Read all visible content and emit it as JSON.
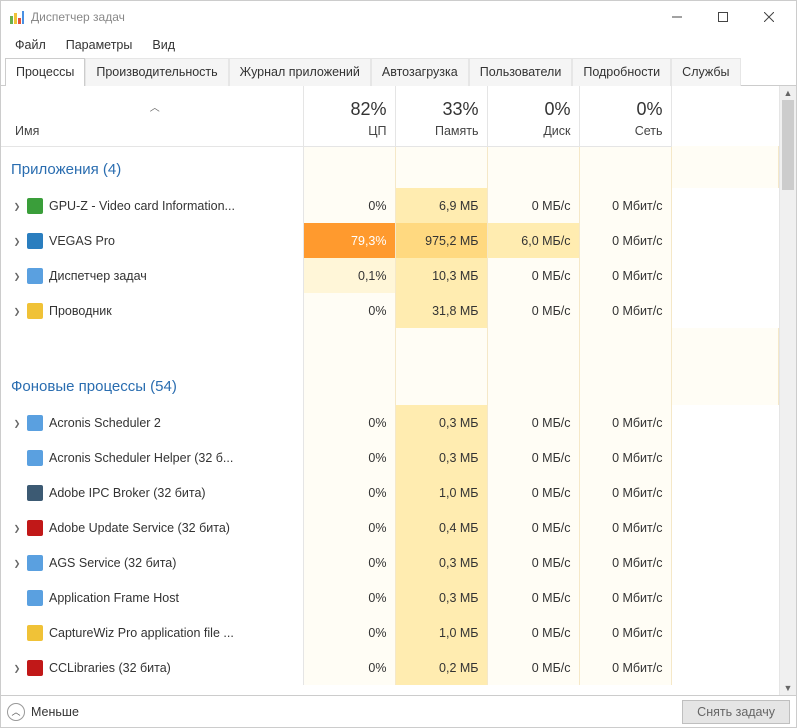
{
  "window": {
    "title": "Диспетчер задач"
  },
  "menu": {
    "file": "Файл",
    "options": "Параметры",
    "view": "Вид"
  },
  "tabs": {
    "processes": "Процессы",
    "performance": "Производительность",
    "apphistory": "Журнал приложений",
    "startup": "Автозагрузка",
    "users": "Пользователи",
    "details": "Подробности",
    "services": "Службы"
  },
  "columns": {
    "name": "Имя",
    "cpu_pct": "82%",
    "cpu_label": "ЦП",
    "mem_pct": "33%",
    "mem_label": "Память",
    "disk_pct": "0%",
    "disk_label": "Диск",
    "net_pct": "0%",
    "net_label": "Сеть"
  },
  "groups": {
    "apps": "Приложения (4)",
    "bg": "Фоновые процессы (54)"
  },
  "rows": {
    "apps": [
      {
        "expand": true,
        "icon": "#3a9e3a",
        "name": "GPU-Z - Video card Information...",
        "cpu": "0%",
        "cpu_h": 0,
        "mem": "6,9 МБ",
        "mem_h": 2,
        "disk": "0 МБ/с",
        "disk_h": 0,
        "net": "0 Мбит/с",
        "net_h": 0
      },
      {
        "expand": true,
        "icon": "#2a7ebf",
        "name": "VEGAS Pro",
        "cpu": "79,3%",
        "cpu_h": 9,
        "mem": "975,2 МБ",
        "mem_h": 3,
        "disk": "6,0 МБ/с",
        "disk_h": 2,
        "net": "0 Мбит/с",
        "net_h": 0
      },
      {
        "expand": true,
        "icon": "#5aa0e0",
        "name": "Диспетчер задач",
        "cpu": "0,1%",
        "cpu_h": 1,
        "mem": "10,3 МБ",
        "mem_h": 2,
        "disk": "0 МБ/с",
        "disk_h": 0,
        "net": "0 Мбит/с",
        "net_h": 0
      },
      {
        "expand": true,
        "icon": "#f0c237",
        "name": "Проводник",
        "cpu": "0%",
        "cpu_h": 0,
        "mem": "31,8 МБ",
        "mem_h": 2,
        "disk": "0 МБ/с",
        "disk_h": 0,
        "net": "0 Мбит/с",
        "net_h": 0
      }
    ],
    "bg": [
      {
        "expand": true,
        "icon": "#5aa0e0",
        "name": "Acronis Scheduler 2",
        "cpu": "0%",
        "cpu_h": 0,
        "mem": "0,3 МБ",
        "mem_h": 2,
        "disk": "0 МБ/с",
        "disk_h": 0,
        "net": "0 Мбит/с",
        "net_h": 0
      },
      {
        "expand": false,
        "icon": "#5aa0e0",
        "name": "Acronis Scheduler Helper (32 б...",
        "cpu": "0%",
        "cpu_h": 0,
        "mem": "0,3 МБ",
        "mem_h": 2,
        "disk": "0 МБ/с",
        "disk_h": 0,
        "net": "0 Мбит/с",
        "net_h": 0
      },
      {
        "expand": false,
        "icon": "#3c5a73",
        "name": "Adobe IPC Broker (32 бита)",
        "cpu": "0%",
        "cpu_h": 0,
        "mem": "1,0 МБ",
        "mem_h": 2,
        "disk": "0 МБ/с",
        "disk_h": 0,
        "net": "0 Мбит/с",
        "net_h": 0
      },
      {
        "expand": true,
        "icon": "#c11818",
        "name": "Adobe Update Service (32 бита)",
        "cpu": "0%",
        "cpu_h": 0,
        "mem": "0,4 МБ",
        "mem_h": 2,
        "disk": "0 МБ/с",
        "disk_h": 0,
        "net": "0 Мбит/с",
        "net_h": 0
      },
      {
        "expand": true,
        "icon": "#5aa0e0",
        "name": "AGS Service (32 бита)",
        "cpu": "0%",
        "cpu_h": 0,
        "mem": "0,3 МБ",
        "mem_h": 2,
        "disk": "0 МБ/с",
        "disk_h": 0,
        "net": "0 Мбит/с",
        "net_h": 0
      },
      {
        "expand": false,
        "icon": "#5aa0e0",
        "name": "Application Frame Host",
        "cpu": "0%",
        "cpu_h": 0,
        "mem": "0,3 МБ",
        "mem_h": 2,
        "disk": "0 МБ/с",
        "disk_h": 0,
        "net": "0 Мбит/с",
        "net_h": 0
      },
      {
        "expand": false,
        "icon": "#f0c237",
        "name": "CaptureWiz Pro application file ...",
        "cpu": "0%",
        "cpu_h": 0,
        "mem": "1,0 МБ",
        "mem_h": 2,
        "disk": "0 МБ/с",
        "disk_h": 0,
        "net": "0 Мбит/с",
        "net_h": 0
      },
      {
        "expand": true,
        "icon": "#c11818",
        "name": "CCLibraries (32 бита)",
        "cpu": "0%",
        "cpu_h": 0,
        "mem": "0,2 МБ",
        "mem_h": 2,
        "disk": "0 МБ/с",
        "disk_h": 0,
        "net": "0 Мбит/с",
        "net_h": 0
      }
    ]
  },
  "footer": {
    "less": "Меньше",
    "end_task": "Снять задачу"
  }
}
